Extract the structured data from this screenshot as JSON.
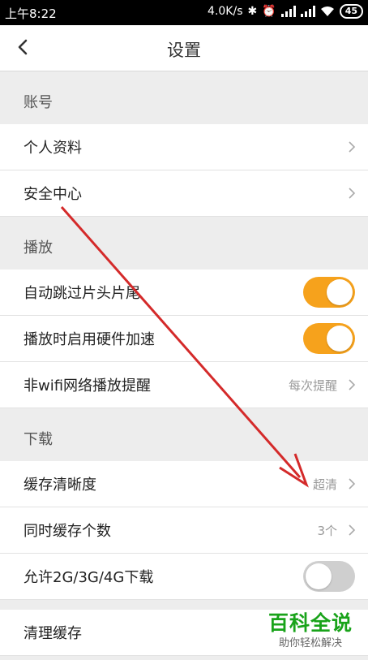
{
  "status_bar": {
    "time": "上午8:22",
    "network_speed": "4.0K/s",
    "battery": "45"
  },
  "header": {
    "title": "设置"
  },
  "sections": {
    "account": {
      "title": "账号",
      "items": [
        {
          "label": "个人资料"
        },
        {
          "label": "安全中心"
        }
      ]
    },
    "playback": {
      "title": "播放",
      "items": [
        {
          "label": "自动跳过片头片尾",
          "toggle": "on"
        },
        {
          "label": "播放时启用硬件加速",
          "toggle": "on"
        },
        {
          "label": "非wifi网络播放提醒",
          "value": "每次提醒"
        }
      ]
    },
    "download": {
      "title": "下载",
      "items": [
        {
          "label": "缓存清晰度",
          "value": "超清"
        },
        {
          "label": "同时缓存个数",
          "value": "3个"
        },
        {
          "label": "允许2G/3G/4G下载",
          "toggle": "off"
        }
      ]
    },
    "other": {
      "items": [
        {
          "label": "清理缓存"
        }
      ]
    }
  },
  "colors": {
    "toggle_on": "#f6a21c",
    "toggle_off": "#cfcfcf",
    "annotation_arrow": "#d42a2a",
    "watermark_green": "#19a31a"
  },
  "watermark": {
    "title": "百科全说",
    "subtitle": "助你轻松解决"
  }
}
